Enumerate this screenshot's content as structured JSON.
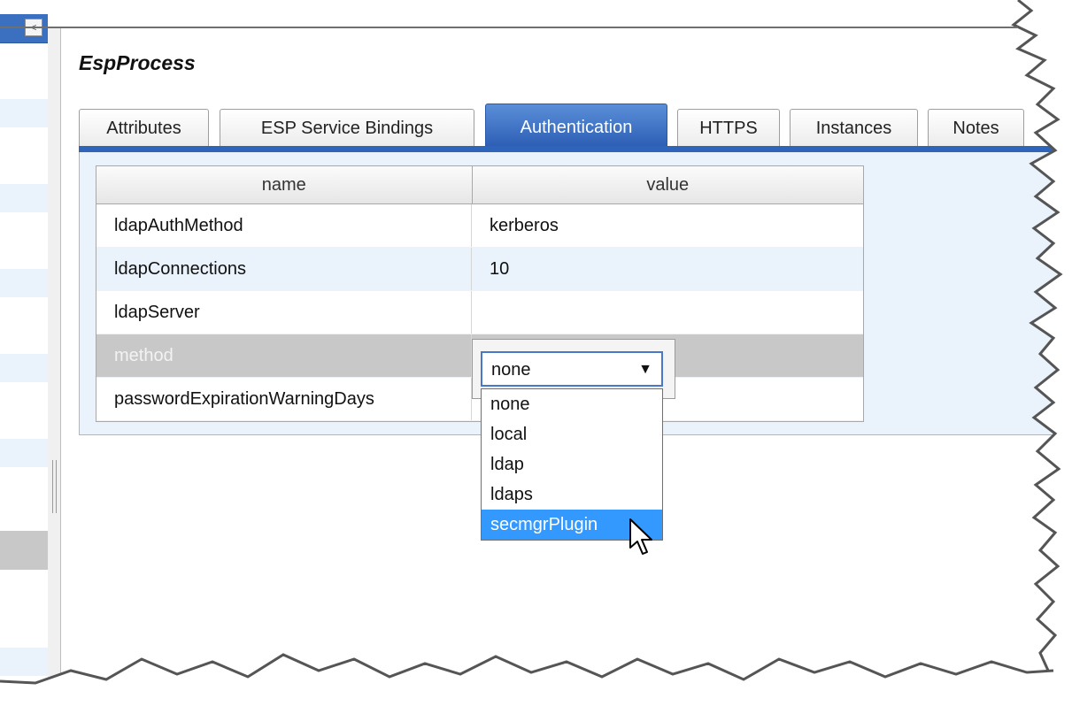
{
  "page": {
    "title": "EspProcess",
    "collapse_glyph": "<"
  },
  "tabs": [
    {
      "label": "Attributes",
      "active": false
    },
    {
      "label": "ESP Service Bindings",
      "active": false
    },
    {
      "label": "Authentication",
      "active": true
    },
    {
      "label": "HTTPS",
      "active": false
    },
    {
      "label": "Instances",
      "active": false
    },
    {
      "label": "Notes",
      "active": false
    }
  ],
  "grid": {
    "columns": [
      "name",
      "value"
    ],
    "rows": [
      {
        "name": "ldapAuthMethod",
        "value": "kerberos"
      },
      {
        "name": "ldapConnections",
        "value": "10"
      },
      {
        "name": "ldapServer",
        "value": ""
      },
      {
        "name": "method",
        "value": ""
      },
      {
        "name": "passwordExpirationWarningDays",
        "value": ""
      }
    ]
  },
  "dropdown": {
    "selected": "none",
    "arrow": "▼",
    "options": [
      "none",
      "local",
      "ldap",
      "ldaps",
      "secmgrPlugin"
    ],
    "highlighted": "secmgrPlugin"
  },
  "colors": {
    "accent": "#2f64bb",
    "highlight": "#3399ff",
    "selected_row": "#c8c8c8",
    "alt_row": "#eaf2fb"
  },
  "icons": {
    "collapse": "chevron-left-icon",
    "cursor": "mouse-pointer-icon"
  }
}
